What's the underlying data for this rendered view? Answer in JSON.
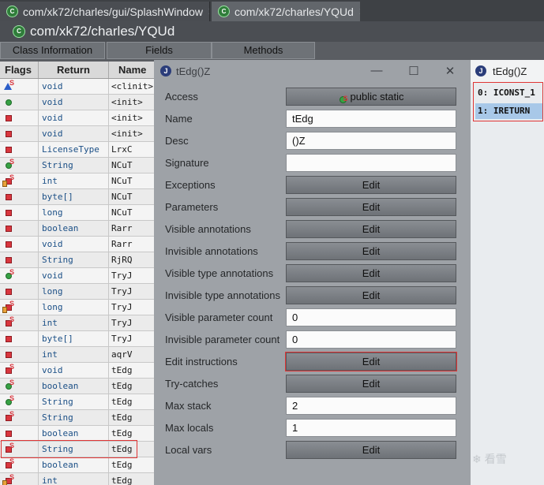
{
  "editor_tabs": [
    {
      "label": "com/xk72/charles/gui/SplashWindow",
      "close": "✕"
    },
    {
      "label": "com/xk72/charles/YQUd",
      "close": "✕"
    }
  ],
  "class_title": "com/xk72/charles/YQUd",
  "class_tabs": [
    "Class Information",
    "Fields",
    "Methods"
  ],
  "methods_table": {
    "headers": [
      "Flags",
      "Return",
      "Name"
    ],
    "rows": [
      {
        "flags": "static-blue",
        "return": "void",
        "name": "<clinit>"
      },
      {
        "flags": "public",
        "return": "void",
        "name": "<init>"
      },
      {
        "flags": "private",
        "return": "void",
        "name": "<init>"
      },
      {
        "flags": "private",
        "return": "void",
        "name": "<init>"
      },
      {
        "flags": "private",
        "return": "LicenseType",
        "name": "LrxC"
      },
      {
        "flags": "public static",
        "return": "String",
        "name": "NCuT"
      },
      {
        "flags": "private static final",
        "return": "int",
        "name": "NCuT"
      },
      {
        "flags": "private",
        "return": "byte[]",
        "name": "NCuT"
      },
      {
        "flags": "private",
        "return": "long",
        "name": "NCuT"
      },
      {
        "flags": "private",
        "return": "boolean",
        "name": "Rarr"
      },
      {
        "flags": "private",
        "return": "void",
        "name": "Rarr"
      },
      {
        "flags": "private",
        "return": "String",
        "name": "RjRQ"
      },
      {
        "flags": "public static",
        "return": "void",
        "name": "TryJ"
      },
      {
        "flags": "private",
        "return": "long",
        "name": "TryJ"
      },
      {
        "flags": "private static final",
        "return": "long",
        "name": "TryJ"
      },
      {
        "flags": "private static",
        "return": "int",
        "name": "TryJ"
      },
      {
        "flags": "private",
        "return": "byte[]",
        "name": "TryJ"
      },
      {
        "flags": "private",
        "return": "int",
        "name": "aqrV"
      },
      {
        "flags": "private static",
        "return": "void",
        "name": "tEdg"
      },
      {
        "flags": "public static",
        "return": "boolean",
        "name": "tEdg"
      },
      {
        "flags": "public static",
        "return": "String",
        "name": "tEdg"
      },
      {
        "flags": "private static",
        "return": "String",
        "name": "tEdg"
      },
      {
        "flags": "private",
        "return": "boolean",
        "name": "tEdg"
      },
      {
        "flags": "private static",
        "return": "String",
        "name": "tEdg"
      },
      {
        "flags": "private static",
        "return": "boolean",
        "name": "tEdg"
      },
      {
        "flags": "private static final",
        "return": "int",
        "name": "tEdg"
      }
    ]
  },
  "dialog": {
    "title": "tEdg()Z",
    "minimize": "—",
    "maximize": "☐",
    "close": "✕",
    "fields": [
      {
        "label": "Access",
        "kind": "button",
        "value": "public static",
        "icon": "public-static-icon"
      },
      {
        "label": "Name",
        "kind": "input",
        "value": "tEdg"
      },
      {
        "label": "Desc",
        "kind": "input",
        "value": "()Z"
      },
      {
        "label": "Signature",
        "kind": "input",
        "value": ""
      },
      {
        "label": "Exceptions",
        "kind": "button",
        "value": "Edit"
      },
      {
        "label": "Parameters",
        "kind": "button",
        "value": "Edit"
      },
      {
        "label": "Visible annotations",
        "kind": "button",
        "value": "Edit"
      },
      {
        "label": "Invisible annotations",
        "kind": "button",
        "value": "Edit"
      },
      {
        "label": "Visible type annotations",
        "kind": "button",
        "value": "Edit"
      },
      {
        "label": "Invisible type annotations",
        "kind": "button",
        "value": "Edit"
      },
      {
        "label": "Visible parameter count",
        "kind": "input",
        "value": "0"
      },
      {
        "label": "Invisible parameter count",
        "kind": "input",
        "value": "0"
      },
      {
        "label": "Edit instructions",
        "kind": "button",
        "value": "Edit",
        "highlighted": true
      },
      {
        "label": "Try-catches",
        "kind": "button",
        "value": "Edit"
      },
      {
        "label": "Max stack",
        "kind": "input",
        "value": "2"
      },
      {
        "label": "Max locals",
        "kind": "input",
        "value": "1"
      },
      {
        "label": "Local vars",
        "kind": "button",
        "value": "Edit"
      }
    ]
  },
  "instructions_pane": {
    "title": "tEdg()Z",
    "items": [
      "0: ICONST_1",
      "1: IRETURN"
    ]
  },
  "watermark": "看雪",
  "colors": {
    "highlight": "#e03535",
    "selection": "#a8c8e8",
    "dialog_bg": "#9ea2a7"
  }
}
